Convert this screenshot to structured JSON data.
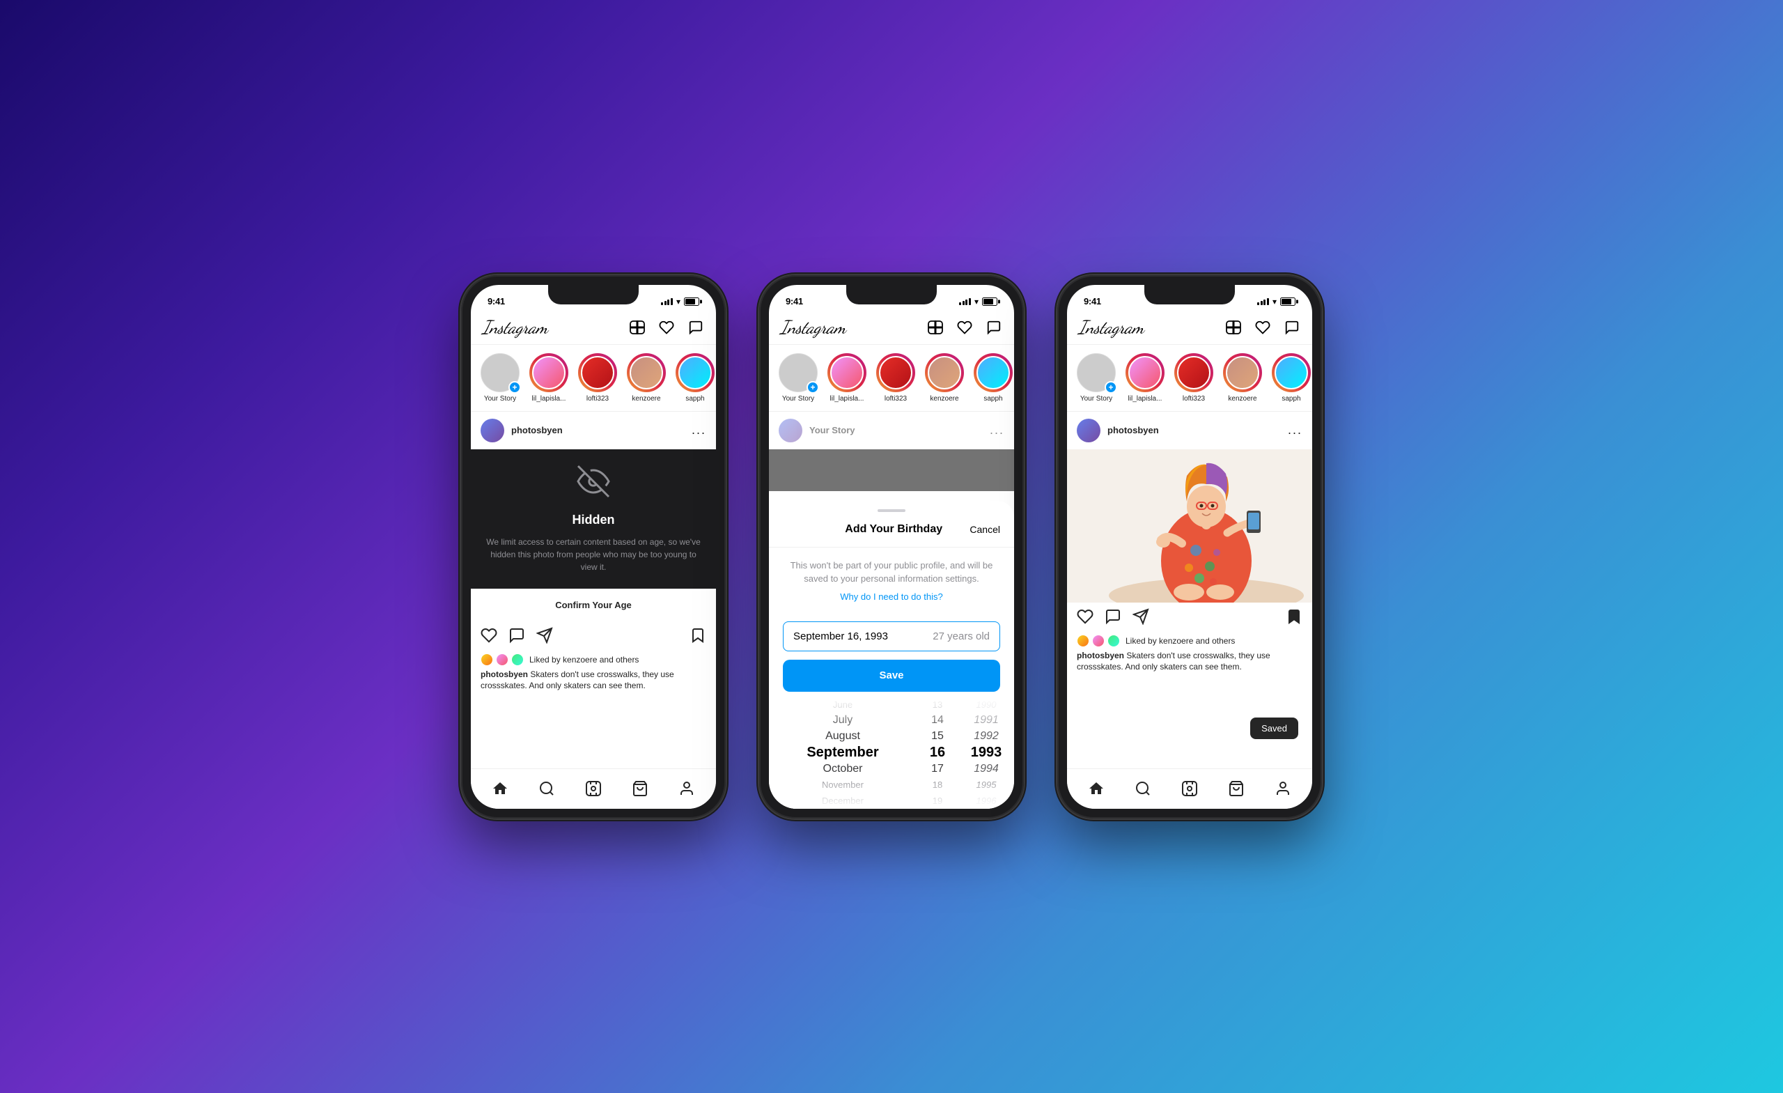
{
  "background": {
    "gradient": "linear-gradient(135deg, #1a0a6b, #3d1a9e, #6b2fc4, #3a8fd4, #1ec8e0)"
  },
  "phones": {
    "left": {
      "status": {
        "time": "9:41",
        "signal": "full",
        "wifi": true,
        "battery": "full"
      },
      "header": {
        "logo": "Instagram",
        "icons": [
          "plus",
          "heart",
          "messenger"
        ]
      },
      "stories": [
        {
          "label": "Your Story",
          "type": "yours"
        },
        {
          "label": "lil_lapisla...",
          "type": "story"
        },
        {
          "label": "lofti323",
          "type": "story"
        },
        {
          "label": "kenzoere",
          "type": "story"
        },
        {
          "label": "sapph",
          "type": "story"
        }
      ],
      "post": {
        "username": "photosbyen",
        "more": "...",
        "hidden": true,
        "hidden_title": "Hidden",
        "hidden_desc": "We limit access to certain content based on age, so we've hidden this photo from people who may be too young to view it.",
        "confirm_age": "Confirm Your Age",
        "action_icons": [
          "heart",
          "comment",
          "share",
          "bookmark"
        ],
        "liked_by": "Liked by kenzoere and others",
        "caption": "photosbyen Skaters don't use crosswalks, they use crossskates. And only skaters can see them."
      },
      "nav": [
        "home",
        "search",
        "reels",
        "shop",
        "profile"
      ]
    },
    "middle": {
      "status": {
        "time": "9:41",
        "signal": "full",
        "wifi": true,
        "battery": "full"
      },
      "header": {
        "logo": "Instagram",
        "icons": [
          "plus",
          "heart",
          "messenger"
        ]
      },
      "stories": [
        {
          "label": "Your Story",
          "type": "yours"
        },
        {
          "label": "lil_lapisla...",
          "type": "story"
        },
        {
          "label": "lofti323",
          "type": "story"
        },
        {
          "label": "kenzoere",
          "type": "story"
        },
        {
          "label": "sapph",
          "type": "story"
        }
      ],
      "birthday_sheet": {
        "handle": true,
        "title": "Add Your Birthday",
        "cancel": "Cancel",
        "desc": "This won't be part of your public profile, and will be saved to your personal information settings.",
        "link": "Why do I need to do this?",
        "date_value": "September 16, 1993",
        "date_age": "27 years old",
        "save_label": "Save",
        "picker": {
          "months": [
            "June",
            "July",
            "August",
            "September",
            "October",
            "November",
            "December"
          ],
          "days": [
            "13",
            "14",
            "15",
            "16",
            "17",
            "18",
            "19"
          ],
          "years": [
            "1990",
            "1991",
            "1992",
            "1993",
            "1994",
            "1995",
            "1996"
          ],
          "selected_month": "September",
          "selected_day": "16",
          "selected_year": "1993"
        }
      }
    },
    "right": {
      "status": {
        "time": "9:41",
        "signal": "full",
        "wifi": true,
        "battery": "full"
      },
      "header": {
        "logo": "Instagram",
        "icons": [
          "plus",
          "heart",
          "messenger"
        ]
      },
      "stories": [
        {
          "label": "Your Story",
          "type": "yours"
        },
        {
          "label": "lil_lapisla...",
          "type": "story"
        },
        {
          "label": "lofti323",
          "type": "story"
        },
        {
          "label": "kenzoere",
          "type": "story"
        },
        {
          "label": "sapph",
          "type": "story"
        }
      ],
      "post": {
        "username": "photosbyen",
        "more": "...",
        "action_icons": [
          "heart",
          "comment",
          "share",
          "bookmark"
        ],
        "liked_by": "Liked by kenzoere and others",
        "caption": "photosbyen Skaters don't use crosswalks, they use crossskates. And only skaters can see them.",
        "saved_toast": "Saved"
      },
      "nav": [
        "home",
        "search",
        "reels",
        "shop",
        "profile"
      ]
    }
  }
}
